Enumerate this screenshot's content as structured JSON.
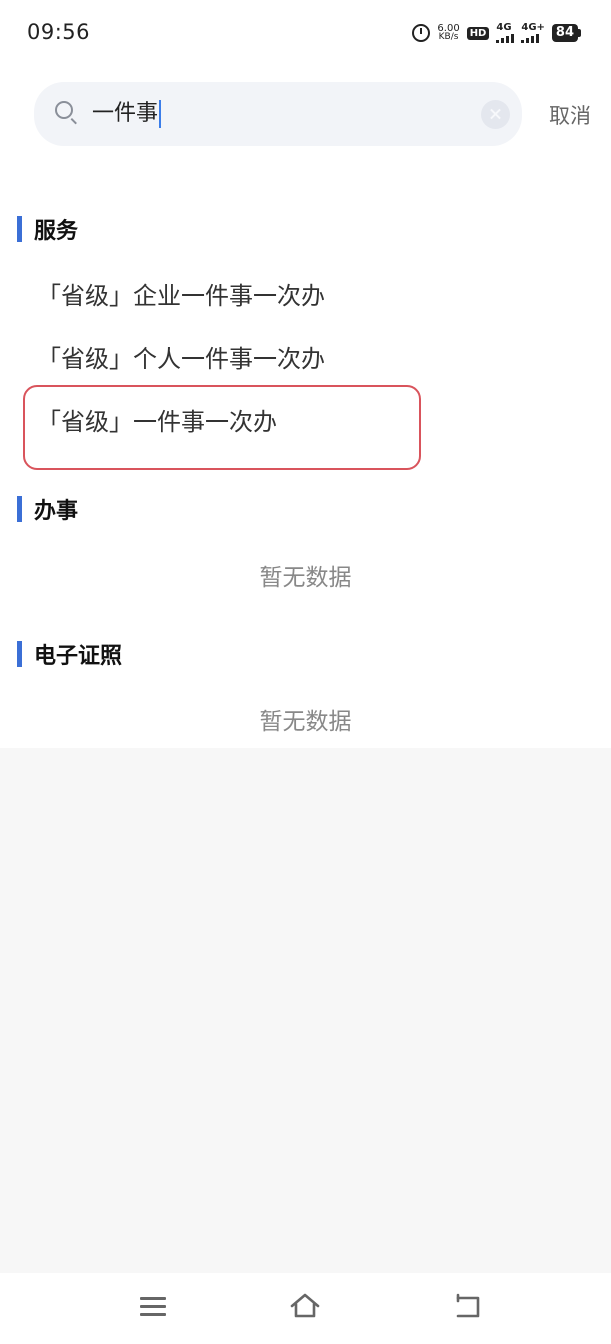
{
  "status_bar": {
    "time": "09:56",
    "net_speed_value": "6.00",
    "net_speed_unit": "KB/s",
    "hd_label": "HD",
    "signal1_label": "4G",
    "signal2_label": "4G+",
    "battery_level": "84"
  },
  "search": {
    "query": "一件事",
    "cancel_label": "取消"
  },
  "sections": {
    "services": {
      "title": "服务",
      "items": [
        "「省级」企业一件事一次办",
        "「省级」个人一件事一次办",
        "「省级」一件事一次办"
      ]
    },
    "affairs": {
      "title": "办事",
      "empty": "暂无数据"
    },
    "certificates": {
      "title": "电子证照",
      "empty": "暂无数据"
    }
  },
  "colors": {
    "accent": "#3b6fd6",
    "highlight_border": "#d9545c",
    "caret": "#3b7de9"
  }
}
